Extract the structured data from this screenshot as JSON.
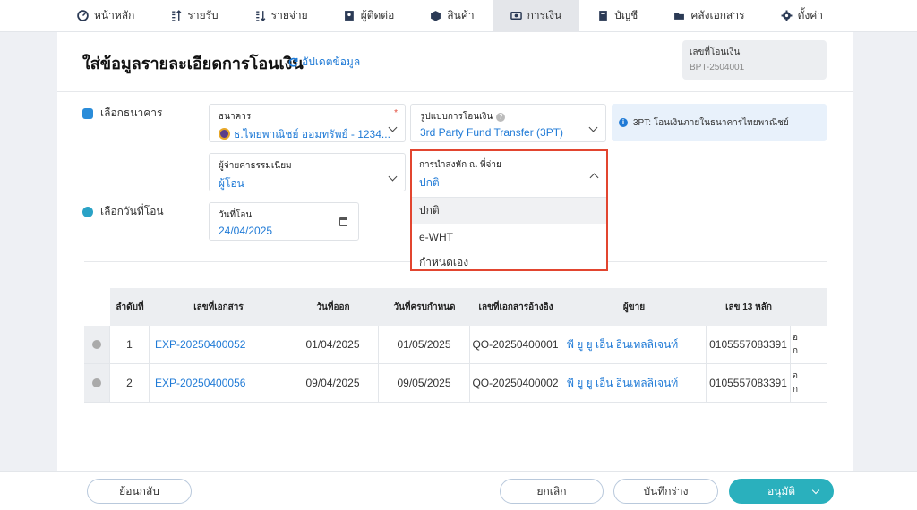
{
  "nav": [
    {
      "label": "หน้าหลัก",
      "icon": "dashboard-icon"
    },
    {
      "label": "รายรับ",
      "icon": "income-icon"
    },
    {
      "label": "รายจ่าย",
      "icon": "expense-icon"
    },
    {
      "label": "ผู้ติดต่อ",
      "icon": "contacts-icon"
    },
    {
      "label": "สินค้า",
      "icon": "box-icon"
    },
    {
      "label": "การเงิน",
      "icon": "money-icon",
      "active": true
    },
    {
      "label": "บัญชี",
      "icon": "book-icon"
    },
    {
      "label": "คลังเอกสาร",
      "icon": "folder-icon"
    },
    {
      "label": "ตั้งค่า",
      "icon": "gear-icon"
    }
  ],
  "page": {
    "title": "ใส่ข้อมูลรายละเอียดการโอนเงิน",
    "refresh_label": "อัปเดตข้อมูล",
    "doc_no_label": "เลขที่โอนเงิน",
    "doc_no_value": "BPT-2504001"
  },
  "sections": {
    "bank_label": "เลือกธนาคาร",
    "date_label": "เลือกวันที่โอน"
  },
  "fields": {
    "bank": {
      "label": "ธนาคาร",
      "value": "ธ.ไทยพาณิชย์ ออมทรัพย์ - 1234...",
      "required": "*"
    },
    "transfer_type": {
      "label": "รูปแบบการโอนเงิน",
      "value": "3rd Party Fund Transfer (3PT)"
    },
    "info": "3PT: โอนเงินภายในธนาคารไทยพาณิชย์",
    "fee_payer": {
      "label": "ผู้จ่ายค่าธรรมเนียม",
      "value": "ผู้โอน"
    },
    "wht": {
      "label": "การนำส่งหัก ณ ที่จ่าย",
      "value": "ปกติ",
      "options": [
        "ปกติ",
        "e-WHT",
        "กำหนดเอง"
      ]
    },
    "date": {
      "label": "วันที่โอน",
      "value": "24/04/2025"
    }
  },
  "table": {
    "headers": [
      "ลำดับที่",
      "เลขที่เอกสาร",
      "วันที่ออก",
      "วันที่ครบกำหนด",
      "เลขที่เอกสารอ้างอิง",
      "ผู้ขาย",
      "เลข 13 หลัก"
    ],
    "rows": [
      {
        "no": "1",
        "doc": "EXP-20250400052",
        "issue": "01/04/2025",
        "due": "01/05/2025",
        "ref": "QO-20250400001",
        "vendor": "พี ยู ยู เอ็น อินเทลลิเจนท์",
        "tax": "0105557083391",
        "more1": "อ",
        "more2": "ก"
      },
      {
        "no": "2",
        "doc": "EXP-20250400056",
        "issue": "09/04/2025",
        "due": "09/05/2025",
        "ref": "QO-20250400002",
        "vendor": "พี ยู ยู เอ็น อินเทลลิเจนท์",
        "tax": "0105557083391",
        "more1": "อ",
        "more2": "ก"
      }
    ]
  },
  "footer": {
    "back": "ย้อนกลับ",
    "cancel": "ยกเลิก",
    "save_draft": "บันทึกร่าง",
    "approve": "อนุมัติ"
  }
}
